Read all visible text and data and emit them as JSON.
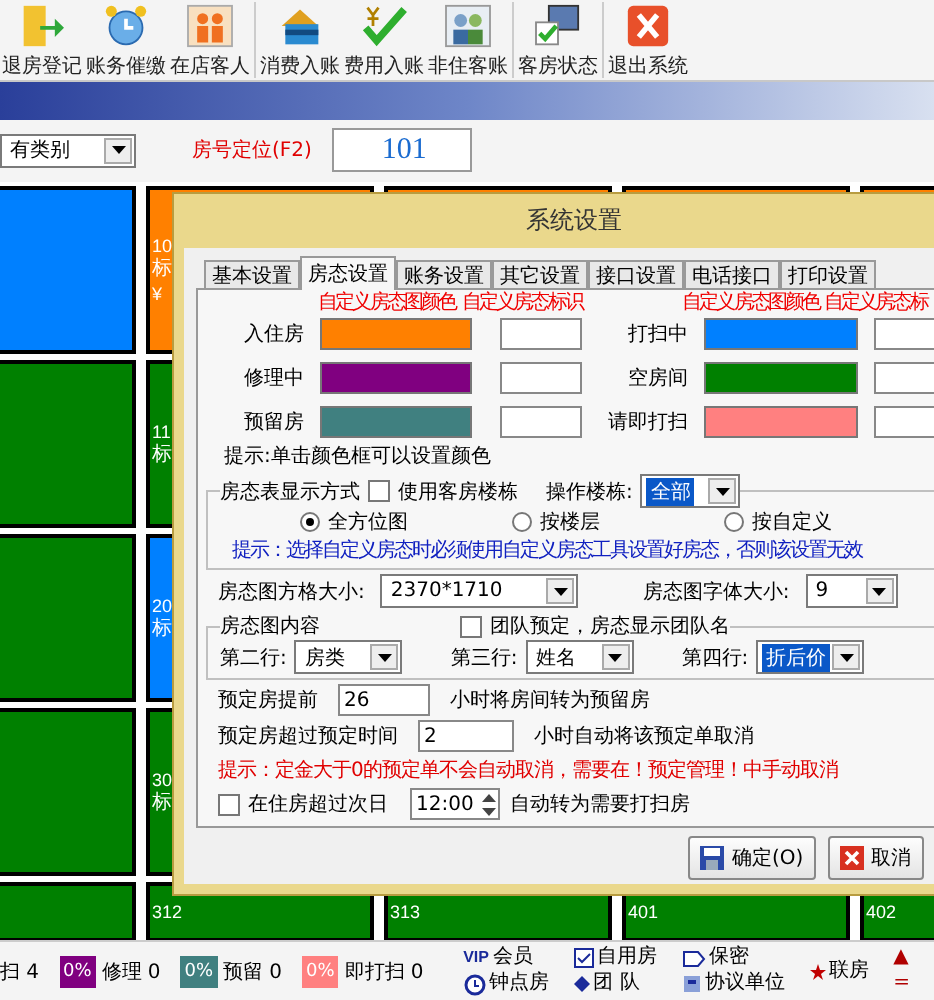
{
  "toolbar_groups": [
    [
      {
        "label": "退房登记",
        "kind": "checkout"
      },
      {
        "label": "账务催缴",
        "kind": "alarm"
      },
      {
        "label": "在店客人",
        "kind": "guests"
      }
    ],
    [
      {
        "label": "消费入账",
        "kind": "card"
      },
      {
        "label": "费用入账",
        "kind": "yen-check"
      },
      {
        "label": "非住客账",
        "kind": "people"
      }
    ],
    [
      {
        "label": "客房状态",
        "kind": "monitor"
      }
    ],
    [
      {
        "label": "退出系统",
        "kind": "exit"
      }
    ]
  ],
  "filter": {
    "category": "有类别",
    "locate_label": "房号定位(F2)",
    "room_number": "101"
  },
  "rooms": [
    [
      {
        "color": "#0080ff"
      },
      {
        "color": "#ff8000",
        "lines": [
          "10",
          "标",
          "¥"
        ]
      },
      {
        "color": "#ff8000"
      },
      {
        "color": "#ff8000"
      },
      {
        "color": "#ff8000"
      }
    ],
    [
      {
        "color": "#008000"
      },
      {
        "color": "#008000",
        "lines": [
          "11",
          "标"
        ]
      }
    ],
    [
      {
        "color": "#008000"
      },
      {
        "color": "#0080ff",
        "lines": [
          "20",
          "标"
        ]
      }
    ],
    [
      {
        "color": "#008000"
      },
      {
        "color": "#008000",
        "lines": [
          "30",
          "标"
        ]
      }
    ],
    [
      {
        "color": "#008000"
      },
      {
        "color": "#008000",
        "lines": [
          "312"
        ]
      },
      {
        "color": "#008000",
        "lines": [
          "313"
        ]
      },
      {
        "color": "#008000",
        "lines": [
          "401"
        ]
      },
      {
        "color": "#008000",
        "lines": [
          "402"
        ]
      }
    ]
  ],
  "dialog": {
    "title": "系统设置",
    "tabs": [
      {
        "label": "基本设置",
        "selected": false
      },
      {
        "label": "房态设置",
        "selected": true
      },
      {
        "label": "账务设置",
        "selected": false
      },
      {
        "label": "其它设置",
        "selected": false
      },
      {
        "label": "接口设置",
        "selected": false
      },
      {
        "label": "电话接口",
        "selected": false
      },
      {
        "label": "打印设置",
        "selected": false
      }
    ],
    "color_headers": [
      "自定义房态图颜色",
      "自定义房态标识",
      "自定义房态图颜色",
      "自定义房态标"
    ],
    "statuses": [
      {
        "label": "入住房",
        "color": "#ff8000"
      },
      {
        "label": "打扫中",
        "color": "#0080ff"
      },
      {
        "label": "修理中",
        "color": "#800080"
      },
      {
        "label": "空房间",
        "color": "#008000"
      },
      {
        "label": "预留房",
        "color": "#408080"
      },
      {
        "label": "请即打扫",
        "color": "#ff8080"
      }
    ],
    "color_hint": "提示:单击颜色框可以设置颜色",
    "display_group": {
      "title": "房态表显示方式",
      "use_building": {
        "label": "使用客房楼栋",
        "checked": false
      },
      "building_label": "操作楼栋:",
      "building": {
        "value": "全部",
        "highlighted": true
      },
      "modes": [
        {
          "label": "全方位图",
          "selected": true
        },
        {
          "label": "按楼层",
          "selected": false
        },
        {
          "label": "按自定义",
          "selected": false
        }
      ],
      "hint": "提示：选择自定义房态时必须使用自定义房态工具设置好房态，否则该设置无效"
    },
    "grid_size_label": "房态图方格大小:",
    "grid_size": {
      "value": "2370*1710",
      "highlighted": false
    },
    "font_size_label": "房态图字体大小:",
    "font_size": {
      "value": "9",
      "highlighted": false
    },
    "content_group": {
      "title": "房态图内容",
      "team": {
        "label": "团队预定，房态显示团队名",
        "checked": false
      },
      "lines": [
        {
          "label": "第二行:",
          "value": "房类",
          "highlighted": false
        },
        {
          "label": "第三行:",
          "value": "姓名",
          "highlighted": false
        },
        {
          "label": "第四行:",
          "value": "折后价",
          "highlighted": true
        }
      ]
    },
    "reserve_ahead": {
      "label": "预定房提前",
      "value": "26",
      "suffix": "小时将房间转为预留房"
    },
    "reserve_expire": {
      "label": "预定房超过预定时间",
      "value": "2",
      "suffix": "小时自动将该预定单取消"
    },
    "warning": "提示：定金大于0的预定单不会自动取消，需要在！预定管理！中手动取消",
    "overnight": {
      "label": "在住房超过次日",
      "checked": false,
      "time": "12:00",
      "suffix": "自动转为需要打扫房"
    },
    "buttons": [
      {
        "label": "确定(O)",
        "kind": "confirm"
      },
      {
        "label": "取消",
        "kind": "cancel"
      }
    ]
  },
  "status_bar": {
    "counts": [
      {
        "kind": "text",
        "label": "扫 4"
      },
      {
        "kind": "swatch",
        "color": "#800080",
        "percent": "0%",
        "label": "修理 0"
      },
      {
        "kind": "swatch",
        "color": "#408080",
        "percent": "0%",
        "label": "预留 0"
      },
      {
        "kind": "swatch",
        "color": "#ff8080",
        "percent": "0%",
        "label": "即打扫 0"
      }
    ],
    "legend_columns": [
      [
        {
          "kind": "badge",
          "badge": "VIP",
          "label": "会员"
        },
        {
          "kind": "clock",
          "label": "钟点房"
        }
      ],
      [
        {
          "kind": "check",
          "label": "自用房"
        },
        {
          "kind": "diamond",
          "label": "团 队"
        }
      ],
      [
        {
          "kind": "tag",
          "label": "保密"
        },
        {
          "kind": "building",
          "label": "协议单位"
        }
      ],
      [
        {
          "kind": "star",
          "label": "联房"
        }
      ],
      [
        {
          "kind": "mark",
          "label": "▲"
        },
        {
          "kind": "mark",
          "label": "="
        }
      ]
    ]
  }
}
